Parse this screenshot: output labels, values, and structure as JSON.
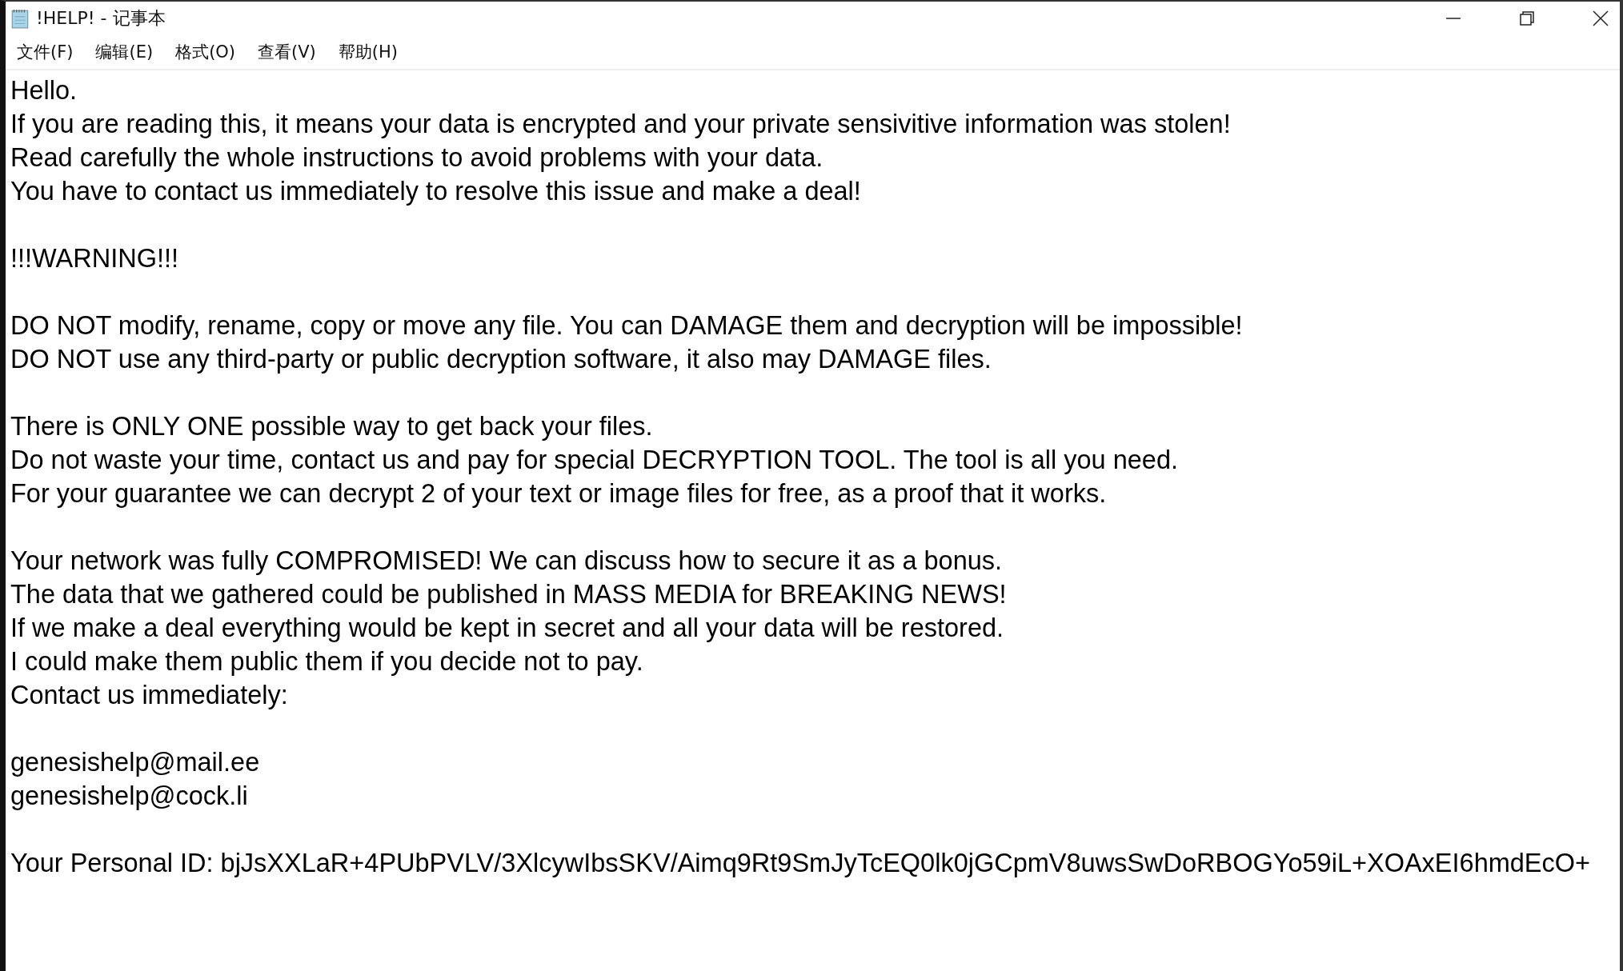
{
  "window": {
    "title": "!HELP! - 记事本"
  },
  "menu": [
    "文件(F)",
    "编辑(E)",
    "格式(O)",
    "查看(V)",
    "帮助(H)"
  ],
  "paragraphs": [
    [
      "Hello.",
      "If you are reading this, it means your data is encrypted and your private sensivitive information was stolen!",
      "Read carefully the whole instructions to avoid problems with your data.",
      "You have to contact us immediately to resolve this issue and make a deal!"
    ],
    [
      "!!!WARNING!!!"
    ],
    [
      "DO NOT modify, rename, copy or move any file. You can DAMAGE them and decryption will be impossible!",
      "DO NOT use any third-party or public decryption software, it also may DAMAGE files."
    ],
    [
      "There is ONLY ONE possible way to get back your files.",
      "Do not waste your time, contact us and pay for special DECRYPTION TOOL. The tool is all you need.",
      "For your guarantee we can decrypt 2 of your text or image files for free, as a proof that it works."
    ],
    [
      "Your network was fully COMPROMISED! We can discuss how to secure it as a bonus.",
      "The data that we gathered could be published in MASS MEDIA for BREAKING NEWS!",
      "If we make a deal everything would be kept in secret and all your data will be restored.",
      "I could make them public them if you decide not to pay.",
      "Contact us immediately:"
    ],
    [
      "genesishelp@mail.ee",
      "genesishelp@cock.li"
    ],
    [
      "Your Personal ID: bjJsXXLaR+4PUbPVLV/3XlcywIbsSKV/Aimq9Rt9SmJyTcEQ0lk0jGCpmV8uwsSwDoRBOGYo59iL+XOAxEI6hmdEcO+"
    ]
  ]
}
